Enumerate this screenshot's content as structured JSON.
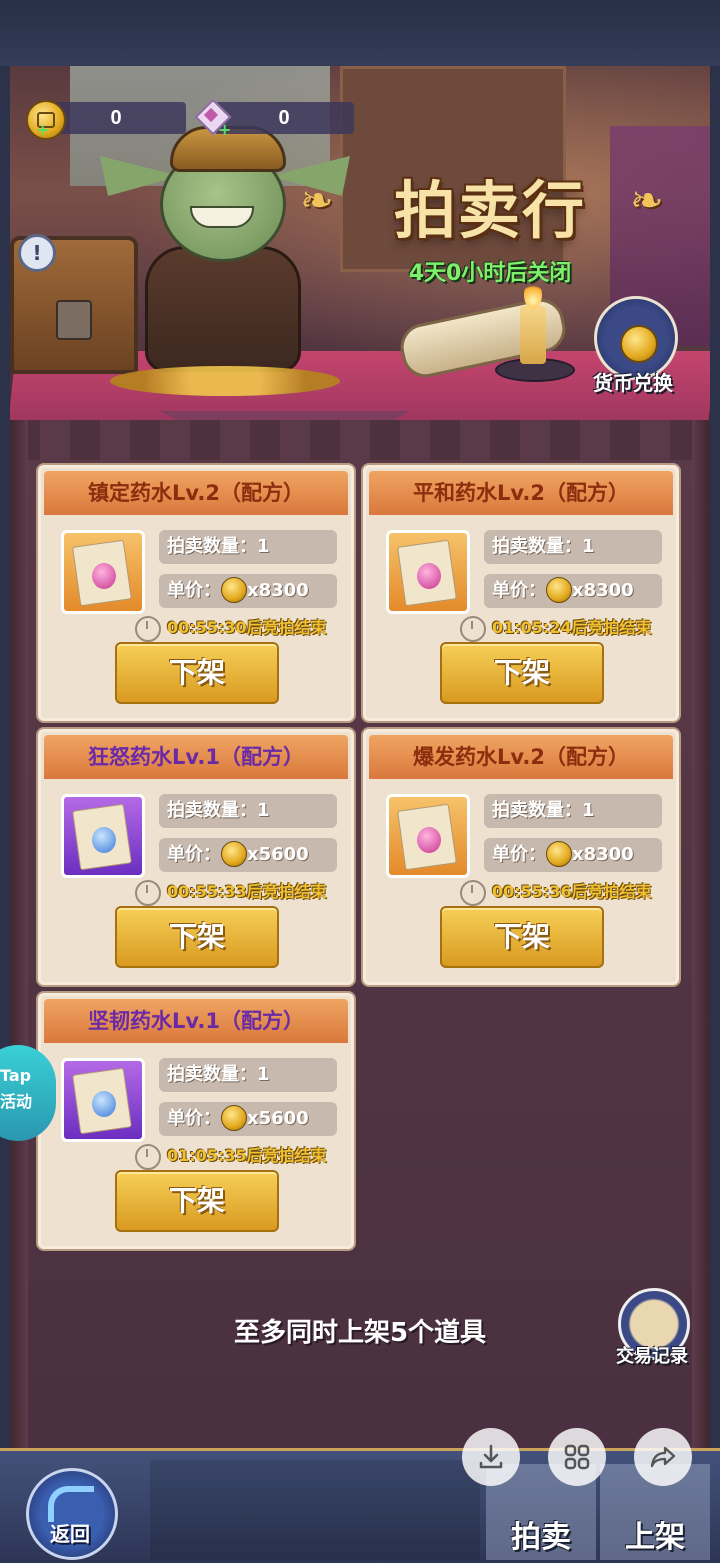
{
  "header": {
    "currencies": [
      {
        "icon": "gold-coin-icon",
        "value": "0"
      },
      {
        "icon": "gem-icon",
        "value": "0"
      }
    ],
    "title": "拍卖行",
    "subtitle": "4天0小时后关闭",
    "exchange_label": "货币兑换",
    "info_icon_text": "!"
  },
  "labels": {
    "quantity_label": "拍卖数量：",
    "price_label": "单价：",
    "unlist_button": "下架"
  },
  "listings": [
    {
      "name": "镇定药水Lv.2（配方）",
      "quantity": "1",
      "price": "x8300",
      "timer": "00:55:30后竞拍结束",
      "rarity": "orange"
    },
    {
      "name": "平和药水Lv.2（配方）",
      "quantity": "1",
      "price": "x8300",
      "timer": "01:05:24后竞拍结束",
      "rarity": "orange"
    },
    {
      "name": "狂怒药水Lv.1（配方）",
      "quantity": "1",
      "price": "x5600",
      "timer": "00:55:33后竞拍结束",
      "rarity": "purple"
    },
    {
      "name": "爆发药水Lv.2（配方）",
      "quantity": "1",
      "price": "x8300",
      "timer": "00:55:36后竞拍结束",
      "rarity": "orange"
    },
    {
      "name": "坚韧药水Lv.1（配方）",
      "quantity": "1",
      "price": "x5600",
      "timer": "01:05:35后竞拍结束",
      "rarity": "purple"
    }
  ],
  "limit_text": "至多同时上架5个道具",
  "trade_record_label": "交易记录",
  "tap_activity": {
    "line1": "Tap",
    "line2": "活动"
  },
  "bottom_nav": {
    "back_label": "返回",
    "auction_tab": "拍卖",
    "list_tab": "上架"
  },
  "colors": {
    "accent_gold": "#f6cf58",
    "card_bg": "#efe1cf",
    "subtitle_green": "#7ef06a",
    "rare_purple": "#6a2aa8"
  }
}
